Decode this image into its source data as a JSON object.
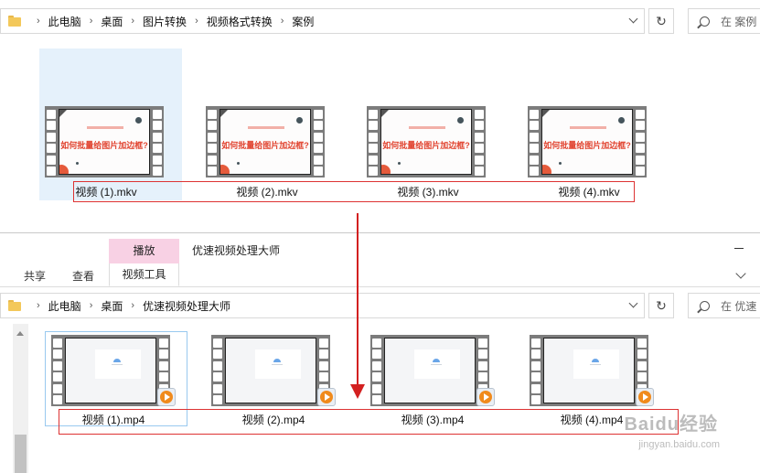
{
  "top_window": {
    "breadcrumb": [
      "此电脑",
      "桌面",
      "图片转换",
      "视频格式转换",
      "案例"
    ],
    "search_placeholder": "在 案例",
    "refresh_icon": "refresh-icon",
    "dropdown_icon": "chevron-down-icon",
    "video_title": "如何批量给图片加边框?",
    "files": [
      "视频 (1).mkv",
      "视频 (2).mkv",
      "视频 (3).mkv",
      "视频 (4).mkv"
    ]
  },
  "bottom_window": {
    "contextual_tab_group": "播放",
    "tabs": [
      "共享",
      "查看",
      "视频工具"
    ],
    "title": "优速视频处理大师",
    "breadcrumb": [
      "此电脑",
      "桌面",
      "优速视频处理大师"
    ],
    "search_placeholder": "在 优速",
    "files": [
      "视频 (1).mp4",
      "视频 (2).mp4",
      "视频 (3).mp4",
      "视频 (4).mp4"
    ]
  },
  "watermark": {
    "text": "Baidu经验",
    "url": "jingyan.baidu.com"
  },
  "colors": {
    "annotation_red": "#d32020",
    "selection_blue": "#e5f1fb",
    "contextual_tab_pink": "#f8d1e4",
    "title_red": "#e1432f"
  }
}
